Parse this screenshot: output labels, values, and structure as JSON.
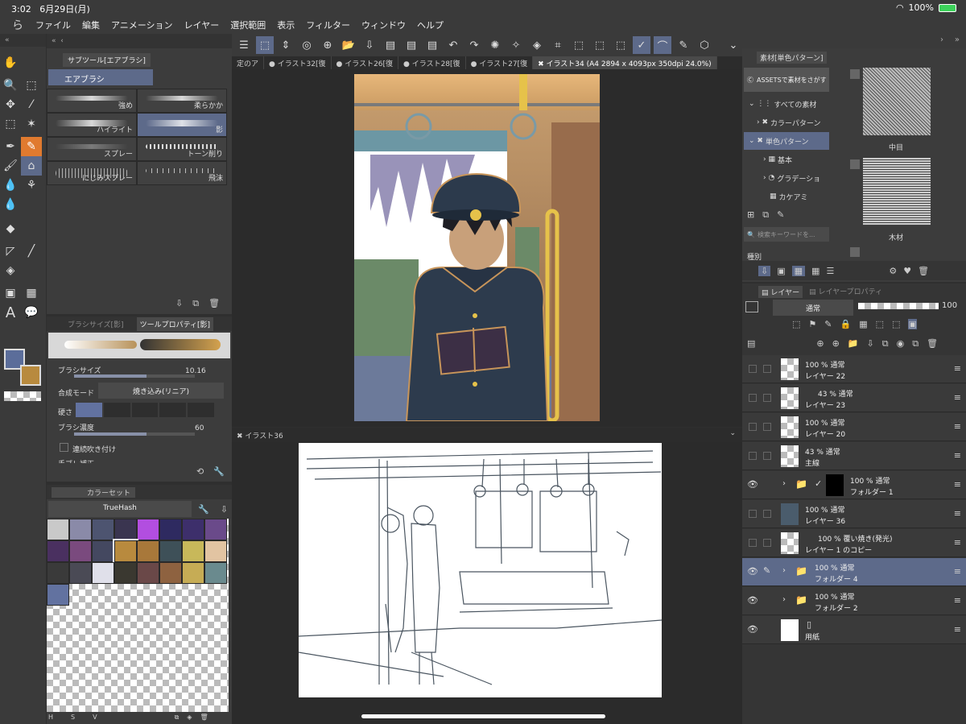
{
  "status": {
    "time": "3:02",
    "date": "6月29日(月)",
    "battery": "100%"
  },
  "menu": [
    "ファイル",
    "編集",
    "アニメーション",
    "レイヤー",
    "選択範囲",
    "表示",
    "フィルター",
    "ウィンドウ",
    "ヘルプ"
  ],
  "subtool": {
    "tab": "サブツール[エアブラシ]",
    "group": "エアブラシ",
    "brushes": [
      "強め",
      "柔らかか",
      "ハイライト",
      "影",
      "スプレー",
      "トーン削り",
      "にじみスプレー",
      "飛沫"
    ]
  },
  "toolprop": {
    "tab1": "ブラシサイズ[影]",
    "tab2": "ツールプロパティ[影]",
    "size_label": "ブラシサイズ",
    "size_value": "10.16",
    "blend_label": "合成モード",
    "blend_value": "焼き込み(リニア)",
    "hardness_label": "硬さ",
    "density_label": "ブラシ濃度",
    "density_value": "60",
    "continuous_label": "連続吹き付け",
    "stabilizer_label": "手ブレ補正"
  },
  "colorset": {
    "tab": "カラーセット",
    "name": "TrueHash",
    "swatches": [
      "#c9c9c9",
      "#8a8aa8",
      "#4d5470",
      "#3a3550",
      "#b24ee0",
      "#2e2a60",
      "#3d2f6b",
      "#6a4a8a",
      "#4a3060",
      "#7a4a7e",
      "#444860",
      "#b88a3e",
      "#a8783a",
      "#3e5058",
      "#c8b85a",
      "#e2c4a2",
      "#3a3a3a",
      "#4a4a55",
      "#e0e0ea",
      "#3a3830",
      "#6a4848",
      "#8e6240",
      "#c6ac55",
      "#6a8a8e",
      "#6272a0"
    ],
    "foot": [
      "H",
      "S",
      "V"
    ]
  },
  "docs": {
    "tabs": [
      "定のア",
      "イラスト32[復",
      "イラスト26[復",
      "イラスト28[復",
      "イラスト27[復",
      "イラスト34 (A4 2894 x 4093px 350dpi 24.0%)"
    ],
    "second_tab": "イラスト36"
  },
  "material": {
    "tab": "素材[単色パターン]",
    "assets": "ASSETSで素材をさがす",
    "tree": [
      "すべての素材",
      "カラーパターン",
      "単色パターン",
      "基本",
      "グラデーショ",
      "カケアミ"
    ],
    "search_placeholder": "検索キーワードを...",
    "kind_label": "種別",
    "thumbs": [
      "中目",
      "木材"
    ]
  },
  "layers": {
    "tab1": "レイヤー",
    "tab2": "レイヤープロパティ",
    "blend": "通常",
    "opacity": "100",
    "rows": [
      {
        "pct": "100 %  通常",
        "name": "レイヤー 22"
      },
      {
        "pct": "43 %  通常",
        "name": "レイヤー 23"
      },
      {
        "pct": "100 %  通常",
        "name": "レイヤー 20"
      },
      {
        "pct": "43 %  通常",
        "name": "主線"
      },
      {
        "pct": "100 %  通常",
        "name": "フォルダー 1"
      },
      {
        "pct": "100 %  通常",
        "name": "レイヤー 36"
      },
      {
        "pct": "100 %  覆い焼き(発光)",
        "name": "レイヤー 1 のコピー"
      },
      {
        "pct": "100 %  通常",
        "name": "フォルダー 4"
      },
      {
        "pct": "100 %  通常",
        "name": "フォルダー 2"
      },
      {
        "pct": "",
        "name": "用紙"
      }
    ]
  }
}
